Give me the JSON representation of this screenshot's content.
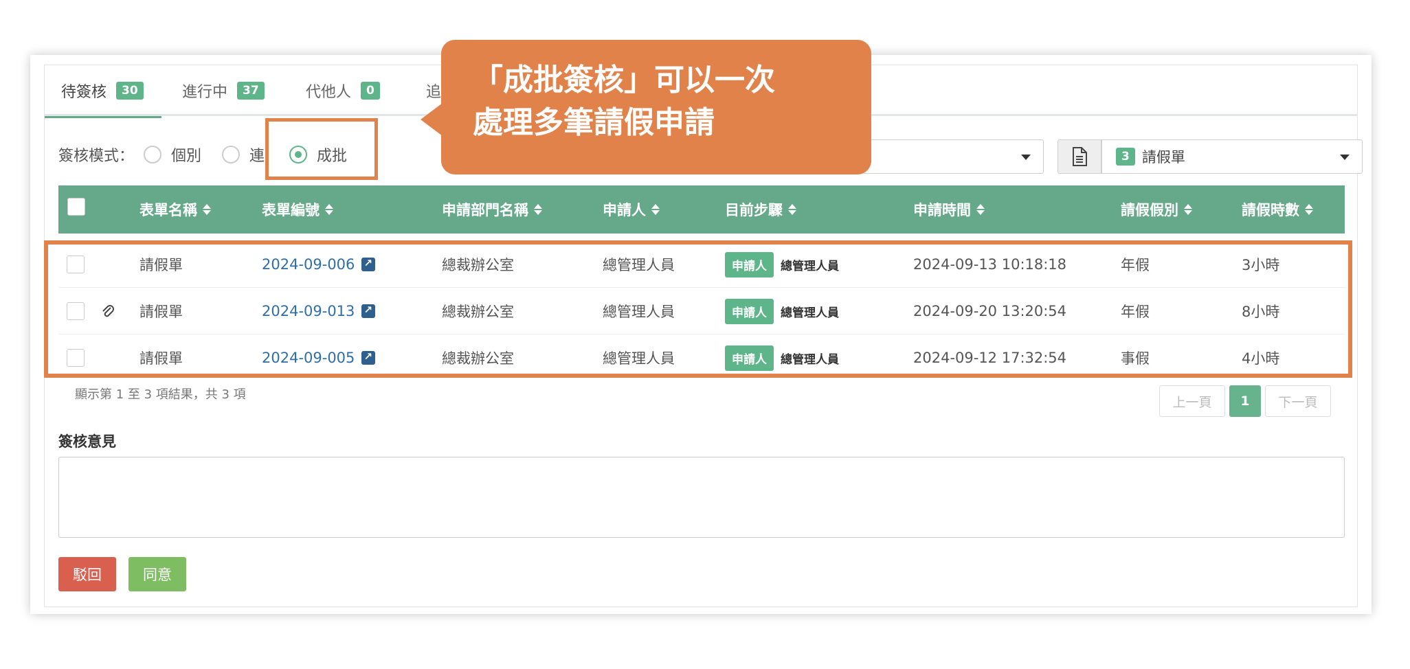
{
  "tabs": [
    {
      "label": "待簽核",
      "count": "30"
    },
    {
      "label": "進行中",
      "count": "37"
    },
    {
      "label": "代他人",
      "count": "0"
    },
    {
      "label": "追"
    }
  ],
  "mode": {
    "label": "簽核模式：",
    "options": [
      "個別",
      "連續",
      "成批"
    ],
    "selected": "成批"
  },
  "form_select": {
    "count": "3",
    "value": "請假單"
  },
  "table": {
    "headers": [
      "表單名稱",
      "表單編號",
      "申請部門名稱",
      "申請人",
      "目前步驟",
      "申請時間",
      "請假假別",
      "請假時數"
    ],
    "rows": [
      {
        "form": "請假單",
        "number": "2024-09-006",
        "dept": "總裁辦公室",
        "applicant": "總管理人員",
        "step_badge": "申請人",
        "step_name": "總管理人員",
        "time": "2024-09-13 10:18:18",
        "leave_type": "年假",
        "hours": "3小時",
        "attachment": false
      },
      {
        "form": "請假單",
        "number": "2024-09-013",
        "dept": "總裁辦公室",
        "applicant": "總管理人員",
        "step_badge": "申請人",
        "step_name": "總管理人員",
        "time": "2024-09-20 13:20:54",
        "leave_type": "年假",
        "hours": "8小時",
        "attachment": true
      },
      {
        "form": "請假單",
        "number": "2024-09-005",
        "dept": "總裁辦公室",
        "applicant": "總管理人員",
        "step_badge": "申請人",
        "step_name": "總管理人員",
        "time": "2024-09-12 17:32:54",
        "leave_type": "事假",
        "hours": "4小時",
        "attachment": false
      }
    ]
  },
  "footer": {
    "info": "顯示第 1 至 3 項結果，共 3 項"
  },
  "pager": {
    "prev": "上一頁",
    "current": "1",
    "next": "下一頁"
  },
  "comment": {
    "label": "簽核意見",
    "value": ""
  },
  "actions": {
    "reject": "駁回",
    "approve": "同意"
  },
  "callout": {
    "line1": "「成批簽核」可以一次",
    "line2": "處理多筆請假申請"
  },
  "colors": {
    "accent": "#66a98a",
    "badge": "#5fb58a",
    "highlight": "#e0824a",
    "reject": "#d9604f",
    "approve": "#7fbd63"
  }
}
